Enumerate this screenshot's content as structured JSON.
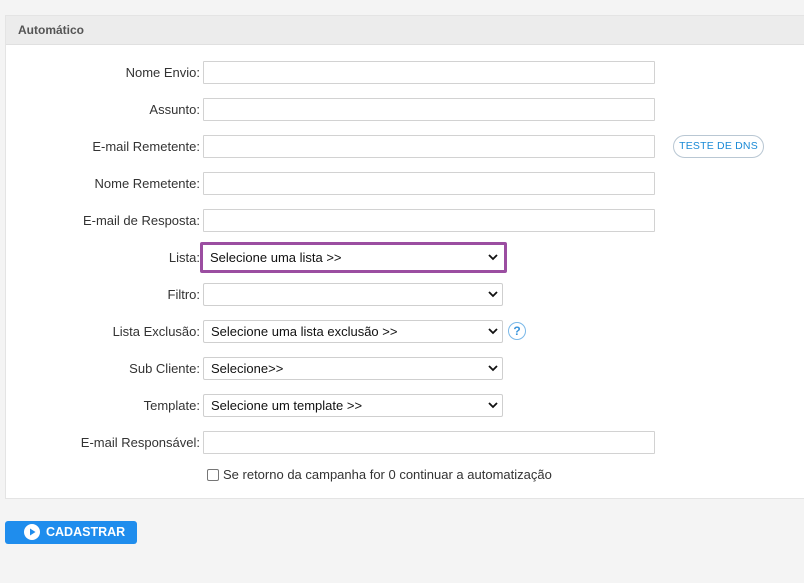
{
  "panel": {
    "title": "Automático"
  },
  "form": {
    "nome_envio": {
      "label": "Nome Envio:",
      "value": ""
    },
    "assunto": {
      "label": "Assunto:",
      "value": ""
    },
    "email_remetente": {
      "label": "E-mail Remetente:",
      "value": ""
    },
    "nome_remetente": {
      "label": "Nome Remetente:",
      "value": ""
    },
    "email_resposta": {
      "label": "E-mail de Resposta:",
      "value": ""
    },
    "lista": {
      "label": "Lista:",
      "selected": "Selecione uma lista >>"
    },
    "filtro": {
      "label": "Filtro:",
      "selected": ""
    },
    "lista_exclusao": {
      "label": "Lista Exclusão:",
      "selected": "Selecione uma lista exclusão >>"
    },
    "sub_cliente": {
      "label": "Sub Cliente:",
      "selected": "Selecione>>"
    },
    "template": {
      "label": "Template:",
      "selected": "Selecione um template >>"
    },
    "email_responsavel": {
      "label": "E-mail Responsável:",
      "value": ""
    },
    "continuar_checkbox": {
      "label": "Se retorno da campanha for 0 continuar a automatização",
      "checked": false
    }
  },
  "buttons": {
    "teste_dns": "TESTE DE DNS",
    "help": "?",
    "cadastrar": "CADASTRAR"
  },
  "colors": {
    "accent": "#1f8ded",
    "highlight_border": "#9b4ea1",
    "dns_text": "#1a8ad6"
  },
  "icons": {
    "submit": "play-circle-icon",
    "select": "chevron-down-icon",
    "help": "question-circle-icon"
  }
}
